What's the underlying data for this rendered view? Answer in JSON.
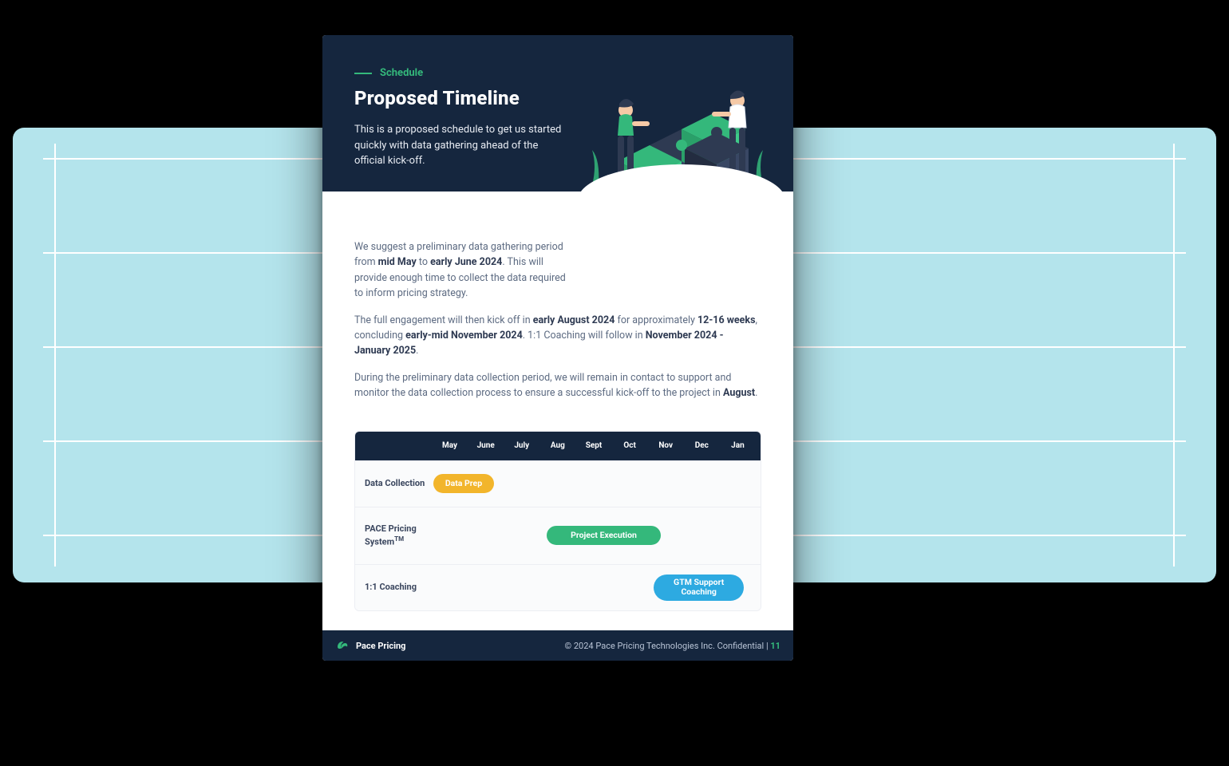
{
  "eyebrow": "Schedule",
  "title": "Proposed Timeline",
  "hero_desc": "This is a proposed schedule to get us started quickly with data gathering ahead of the official kick-off.",
  "body": {
    "p1_a": "We suggest a preliminary data gathering period from ",
    "p1_b1": "mid May",
    "p1_c": " to ",
    "p1_b2": "early June 2024",
    "p1_d": ". This will provide enough time to collect the data required to inform pricing strategy.",
    "p2_a": "The full engagement will then kick off in ",
    "p2_b1": "early August 2024",
    "p2_c": " for approximately ",
    "p2_b2": "12-16 weeks",
    "p2_d": ", concluding ",
    "p2_b3": "early-mid November 2024",
    "p2_e": ". 1:1 Coaching will follow in ",
    "p2_b4": "November 2024 - January 2025",
    "p2_f": ".",
    "p3_a": "During the preliminary data collection period, we will remain in contact to support and monitor the data collection process to ensure a successful kick-off to the project in ",
    "p3_b1": "August",
    "p3_c": "."
  },
  "gantt": {
    "months": [
      "May",
      "June",
      "July",
      "Aug",
      "Sept",
      "Oct",
      "Nov",
      "Dec",
      "Jan"
    ],
    "rows": [
      {
        "label": "Data Collection",
        "bar": {
          "text": "Data Prep",
          "color": "yellow",
          "left_pct": 2,
          "width_pct": 18
        }
      },
      {
        "label_html": "PACE Pricing System",
        "tm": "TM",
        "bar": {
          "text": "Project Execution",
          "color": "green",
          "left_pct": 36,
          "width_pct": 34
        }
      },
      {
        "label": "1:1 Coaching",
        "bar": {
          "text": "GTM Support Coaching",
          "color": "blue",
          "left_pct": 68,
          "width_pct": 27,
          "multiline": true
        }
      }
    ]
  },
  "footer": {
    "brand": "Pace Pricing",
    "copyright": "© 2024 Pace Pricing Technologies Inc. Confidential | ",
    "page": "11"
  },
  "colors": {
    "accent_green": "#34B87B",
    "navy": "#15263E",
    "yellow": "#F2B52B",
    "blue": "#2DAAE1"
  }
}
